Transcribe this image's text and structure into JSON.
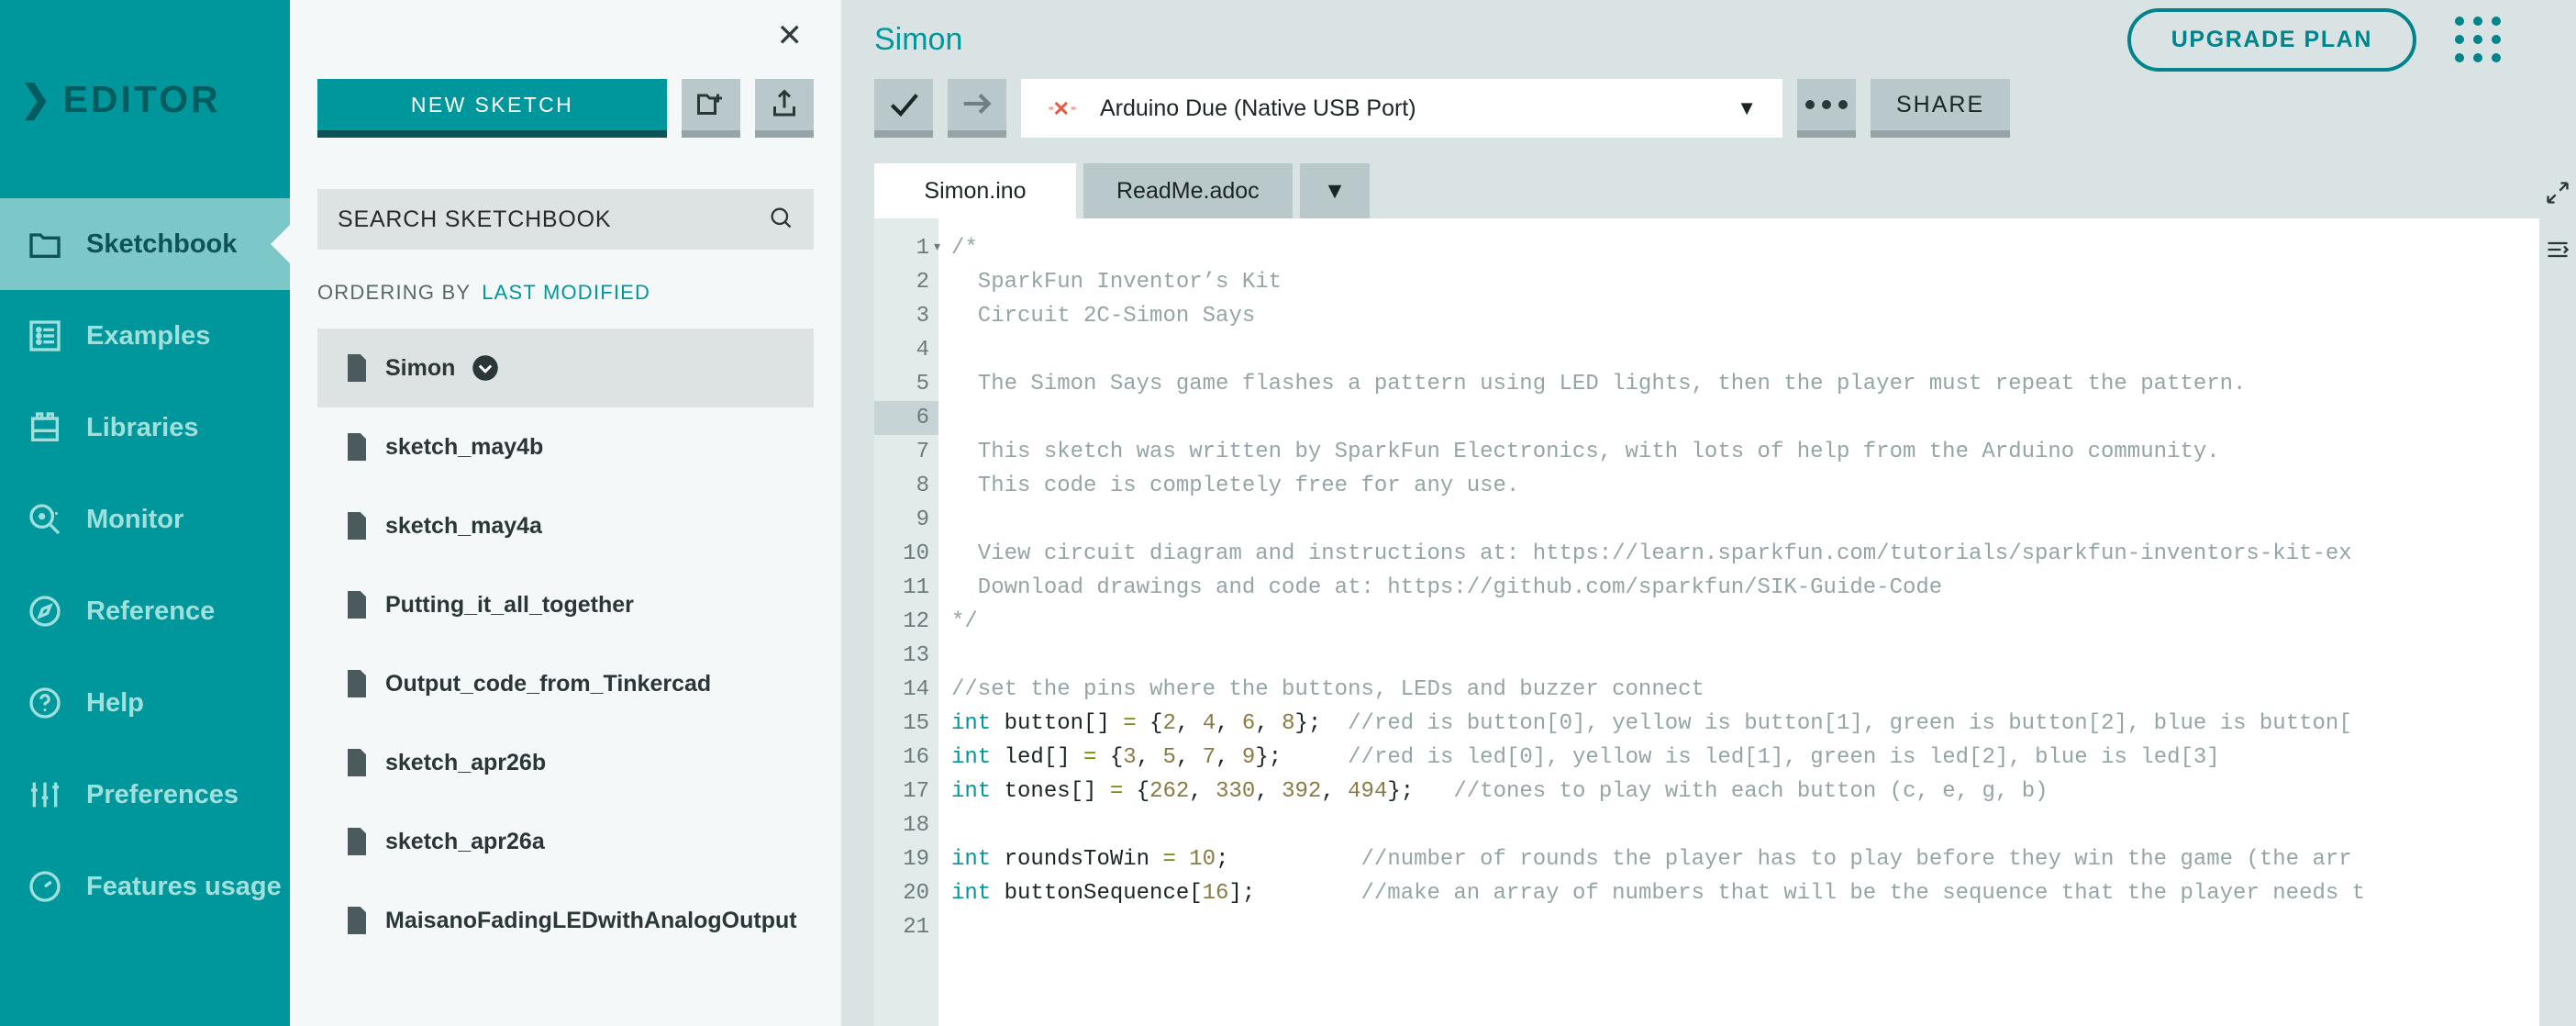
{
  "brand": {
    "name": "EDITOR",
    "chevron": "chevron-right-icon"
  },
  "sidebar": {
    "items": [
      {
        "label": "Sketchbook",
        "icon": "folder-icon",
        "active": true
      },
      {
        "label": "Examples",
        "icon": "list-icon",
        "active": false
      },
      {
        "label": "Libraries",
        "icon": "library-icon",
        "active": false
      },
      {
        "label": "Monitor",
        "icon": "monitor-search-icon",
        "active": false
      },
      {
        "label": "Reference",
        "icon": "compass-icon",
        "active": false
      },
      {
        "label": "Help",
        "icon": "question-circle-icon",
        "active": false
      },
      {
        "label": "Preferences",
        "icon": "sliders-icon",
        "active": false
      },
      {
        "label": "Features usage",
        "icon": "gauge-icon",
        "active": false
      }
    ]
  },
  "panel": {
    "close_icon": "close-icon",
    "new_sketch_label": "NEW SKETCH",
    "new_folder_icon": "new-folder-icon",
    "upload_icon": "upload-icon",
    "search_placeholder": "SEARCH SKETCHBOOK",
    "search_value": "",
    "search_icon": "search-icon",
    "ordering_label": "ORDERING BY",
    "ordering_value": "LAST MODIFIED",
    "sketches": [
      {
        "name": "Simon",
        "selected": true,
        "has_caret": true
      },
      {
        "name": "sketch_may4b",
        "selected": false,
        "has_caret": false
      },
      {
        "name": "sketch_may4a",
        "selected": false,
        "has_caret": false
      },
      {
        "name": "Putting_it_all_together",
        "selected": false,
        "has_caret": false
      },
      {
        "name": "Output_code_from_Tinkercad",
        "selected": false,
        "has_caret": false
      },
      {
        "name": "sketch_apr26b",
        "selected": false,
        "has_caret": false
      },
      {
        "name": "sketch_apr26a",
        "selected": false,
        "has_caret": false
      },
      {
        "name": "MaisanoFadingLEDwithAnalogOutput",
        "selected": false,
        "has_caret": false
      }
    ]
  },
  "header": {
    "sketch_title": "Simon",
    "upgrade_label": "UPGRADE PLAN",
    "apps_grid_icon": "apps-grid-icon",
    "avatar_icon": "avatar-icon"
  },
  "toolbar": {
    "verify_icon": "checkmark-icon",
    "upload_icon": "arrow-right-icon",
    "board": {
      "status_icon": "board-disconnected-icon",
      "name": "Arduino Due (Native USB Port)",
      "caret_icon": "chevron-down-icon"
    },
    "more_icon": "ellipsis-icon",
    "share_label": "SHARE"
  },
  "tabs": {
    "items": [
      {
        "label": "Simon.ino",
        "active": true
      },
      {
        "label": "ReadMe.adoc",
        "active": false
      }
    ],
    "dropdown_icon": "chevron-down-icon"
  },
  "editor": {
    "current_line": 6,
    "lines": [
      {
        "n": 1,
        "fold": true,
        "tokens": [
          {
            "t": "/*",
            "c": "cm"
          }
        ]
      },
      {
        "n": 2,
        "tokens": [
          {
            "t": "  SparkFun Inventor’s Kit",
            "c": "cm"
          }
        ]
      },
      {
        "n": 3,
        "tokens": [
          {
            "t": "  Circuit 2C-Simon Says",
            "c": "cm"
          }
        ]
      },
      {
        "n": 4,
        "tokens": [
          {
            "t": "",
            "c": "cm"
          }
        ]
      },
      {
        "n": 5,
        "tokens": [
          {
            "t": "  The Simon Says game flashes a pattern using LED lights, then the player must repeat the pattern.",
            "c": "cm"
          }
        ]
      },
      {
        "n": 6,
        "tokens": [
          {
            "t": "",
            "c": "cm"
          }
        ]
      },
      {
        "n": 7,
        "tokens": [
          {
            "t": "  This sketch was written by SparkFun Electronics, with lots of help from the Arduino community.",
            "c": "cm"
          }
        ]
      },
      {
        "n": 8,
        "tokens": [
          {
            "t": "  This code is completely free for any use.",
            "c": "cm"
          }
        ]
      },
      {
        "n": 9,
        "tokens": [
          {
            "t": "",
            "c": "cm"
          }
        ]
      },
      {
        "n": 10,
        "tokens": [
          {
            "t": "  View circuit diagram and instructions at: https://learn.sparkfun.com/tutorials/sparkfun-inventors-kit-ex",
            "c": "cm"
          }
        ]
      },
      {
        "n": 11,
        "tokens": [
          {
            "t": "  Download drawings and code at: https://github.com/sparkfun/SIK-Guide-Code",
            "c": "cm"
          }
        ]
      },
      {
        "n": 12,
        "tokens": [
          {
            "t": "*/",
            "c": "cm"
          }
        ]
      },
      {
        "n": 13,
        "tokens": [
          {
            "t": "",
            "c": "cm"
          }
        ]
      },
      {
        "n": 14,
        "tokens": [
          {
            "t": "//set the pins where the buttons, LEDs and buzzer connect",
            "c": "cm"
          }
        ]
      },
      {
        "n": 15,
        "tokens": [
          {
            "t": "int",
            "c": "kw"
          },
          {
            "t": " button[] ",
            "c": ""
          },
          {
            "t": "=",
            "c": "op"
          },
          {
            "t": " {",
            "c": ""
          },
          {
            "t": "2",
            "c": "num"
          },
          {
            "t": ", ",
            "c": ""
          },
          {
            "t": "4",
            "c": "num"
          },
          {
            "t": ", ",
            "c": ""
          },
          {
            "t": "6",
            "c": "num"
          },
          {
            "t": ", ",
            "c": ""
          },
          {
            "t": "8",
            "c": "num"
          },
          {
            "t": "};  ",
            "c": ""
          },
          {
            "t": "//red is button[0], yellow is button[1], green is button[2], blue is button[",
            "c": "cm"
          }
        ]
      },
      {
        "n": 16,
        "tokens": [
          {
            "t": "int",
            "c": "kw"
          },
          {
            "t": " led[] ",
            "c": ""
          },
          {
            "t": "=",
            "c": "op"
          },
          {
            "t": " {",
            "c": ""
          },
          {
            "t": "3",
            "c": "num"
          },
          {
            "t": ", ",
            "c": ""
          },
          {
            "t": "5",
            "c": "num"
          },
          {
            "t": ", ",
            "c": ""
          },
          {
            "t": "7",
            "c": "num"
          },
          {
            "t": ", ",
            "c": ""
          },
          {
            "t": "9",
            "c": "num"
          },
          {
            "t": "};     ",
            "c": ""
          },
          {
            "t": "//red is led[0], yellow is led[1], green is led[2], blue is led[3]",
            "c": "cm"
          }
        ]
      },
      {
        "n": 17,
        "tokens": [
          {
            "t": "int",
            "c": "kw"
          },
          {
            "t": " tones[] ",
            "c": ""
          },
          {
            "t": "=",
            "c": "op"
          },
          {
            "t": " {",
            "c": ""
          },
          {
            "t": "262",
            "c": "num"
          },
          {
            "t": ", ",
            "c": ""
          },
          {
            "t": "330",
            "c": "num"
          },
          {
            "t": ", ",
            "c": ""
          },
          {
            "t": "392",
            "c": "num"
          },
          {
            "t": ", ",
            "c": ""
          },
          {
            "t": "494",
            "c": "num"
          },
          {
            "t": "};   ",
            "c": ""
          },
          {
            "t": "//tones to play with each button (c, e, g, b)",
            "c": "cm"
          }
        ]
      },
      {
        "n": 18,
        "tokens": [
          {
            "t": "",
            "c": ""
          }
        ]
      },
      {
        "n": 19,
        "tokens": [
          {
            "t": "int",
            "c": "kw"
          },
          {
            "t": " roundsToWin ",
            "c": ""
          },
          {
            "t": "=",
            "c": "op"
          },
          {
            "t": " ",
            "c": ""
          },
          {
            "t": "10",
            "c": "num"
          },
          {
            "t": ";          ",
            "c": ""
          },
          {
            "t": "//number of rounds the player has to play before they win the game (the arr",
            "c": "cm"
          }
        ]
      },
      {
        "n": 20,
        "tokens": [
          {
            "t": "int",
            "c": "kw"
          },
          {
            "t": " buttonSequence[",
            "c": ""
          },
          {
            "t": "16",
            "c": "num"
          },
          {
            "t": "];        ",
            "c": ""
          },
          {
            "t": "//make an array of numbers that will be the sequence that the player needs t",
            "c": "cm"
          }
        ]
      },
      {
        "n": 21,
        "tokens": [
          {
            "t": "",
            "c": ""
          }
        ]
      }
    ]
  },
  "rightedge": {
    "expand_icon": "expand-arrows-icon",
    "console_icon": "console-icon"
  },
  "colors": {
    "teal": "#00979c",
    "teal_dark": "#0d5257",
    "teal_light": "#7cc7c7",
    "panel_bg": "#f4f8f8",
    "main_bg": "#dae3e3",
    "button_gray": "#b9c8ca",
    "accent_orange": "#e8563f"
  }
}
